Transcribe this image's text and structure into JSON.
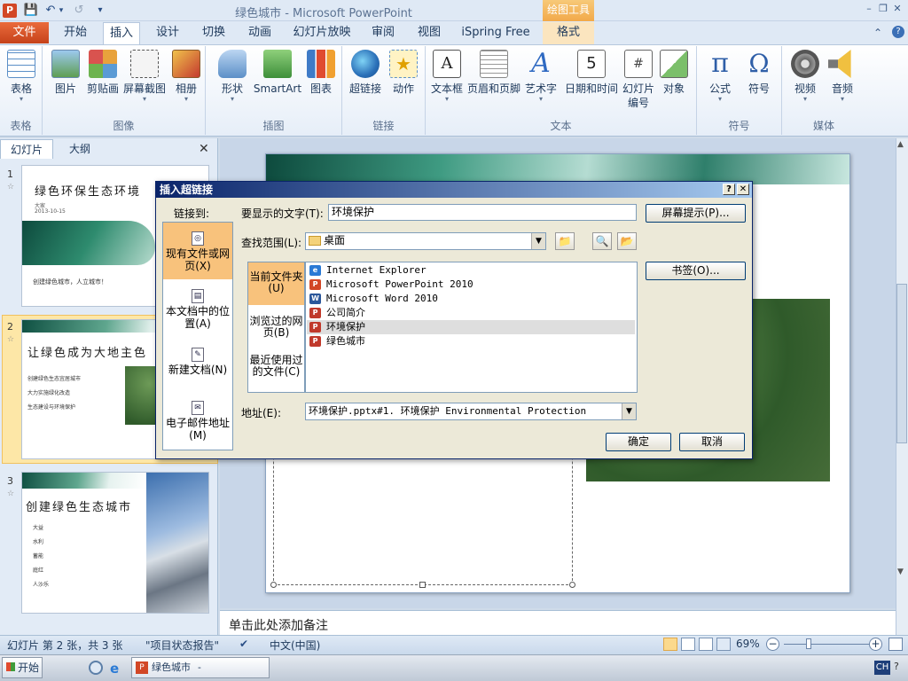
{
  "app": {
    "icon_letter": "P",
    "title": "绿色城市 - Microsoft PowerPoint",
    "context_tool": "绘图工具",
    "qat": {
      "save": "💾",
      "undo": "↶",
      "undo_arrow": "▾",
      "redo": "↺",
      "customize": "▾"
    },
    "window_buttons": {
      "minimize": "–",
      "restore": "❐",
      "close": "✕"
    },
    "ribbon_controls": {
      "help": "?",
      "minimize": "⌃"
    }
  },
  "tabs": [
    "文件",
    "开始",
    "插入",
    "设计",
    "切换",
    "动画",
    "幻灯片放映",
    "审阅",
    "视图",
    "iSpring Free",
    "格式"
  ],
  "ribbon": {
    "groups": [
      {
        "label": "表格",
        "buttons": [
          "表格"
        ]
      },
      {
        "label": "图像",
        "buttons": [
          "图片",
          "剪贴画",
          "屏幕截图",
          "相册"
        ]
      },
      {
        "label": "插图",
        "buttons": [
          "形状",
          "SmartArt",
          "图表"
        ]
      },
      {
        "label": "链接",
        "buttons": [
          "超链接",
          "动作"
        ]
      },
      {
        "label": "文本",
        "buttons": [
          "文本框",
          "页眉和页脚",
          "艺术字",
          "日期和时间",
          "幻灯片编号",
          "对象"
        ]
      },
      {
        "label": "符号",
        "buttons": [
          "公式",
          "符号"
        ]
      },
      {
        "label": "媒体",
        "buttons": [
          "视频",
          "音频"
        ]
      }
    ],
    "icon_glyphs": {
      "formula": "π",
      "symbol": "Ω",
      "wordart": "A",
      "textbox": "A",
      "slide_number": "#",
      "datetime": "5"
    }
  },
  "left_pane": {
    "tab_slides": "幻灯片",
    "tab_outline": "大纲",
    "close": "✕",
    "slides": [
      {
        "num": "1",
        "star": "☆",
        "title": "绿色环保生态环境",
        "sub1": "大家",
        "sub2": "2013-10-15",
        "footer": "创建绿色城市，人立城市！"
      },
      {
        "num": "2",
        "star": "☆",
        "title": "让绿色成为大地主色",
        "bullets": [
          "创建绿色生态宜居城市",
          "大力实施绿化改造",
          "生态建设与环境保护"
        ]
      },
      {
        "num": "3",
        "star": "☆",
        "title": "创建绿色生态城市",
        "bullets": [
          "大益",
          "水利",
          "蓄能",
          "庭红",
          "人沙乐"
        ]
      }
    ]
  },
  "notes_placeholder": "单击此处添加备注",
  "status": {
    "slide_info": "幻灯片 第 2 张，共 3 张",
    "theme": "\"项目状态报告\"",
    "language": "中文(中国)",
    "zoom": "69%",
    "zoom_out": "−",
    "zoom_in": "+"
  },
  "taskbar": {
    "start": "开始",
    "window_item": "绿色城市 - Microsof...",
    "ime": "CH"
  },
  "dialog": {
    "title": "插入超链接",
    "help_btn": "?",
    "close_btn": "✕",
    "link_to_label": "链接到:",
    "link_to_items": [
      {
        "label": "现有文件或网页(X)",
        "selected": true
      },
      {
        "label": "本文档中的位置(A)",
        "selected": false
      },
      {
        "label": "新建文档(N)",
        "selected": false
      },
      {
        "label": "电子邮件地址(M)",
        "selected": false
      }
    ],
    "text_to_display_label": "要显示的文字(T):",
    "text_to_display_value": "环境保护",
    "screentip_button": "屏幕提示(P)...",
    "look_in_label": "查找范围(L):",
    "look_in_value": "桌面",
    "side_items": [
      {
        "label": "当前文件夹(U)",
        "selected": true
      },
      {
        "label": "浏览过的网页(B)",
        "selected": false
      },
      {
        "label": "最近使用过的文件(C)",
        "selected": false
      }
    ],
    "files": [
      {
        "name": "Internet Explorer",
        "icon": "e",
        "color": "#2a7ad5",
        "selected": false
      },
      {
        "name": "Microsoft PowerPoint 2010",
        "icon": "P",
        "color": "#d24726",
        "selected": false
      },
      {
        "name": "Microsoft Word 2010",
        "icon": "W",
        "color": "#2b579a",
        "selected": false
      },
      {
        "name": "公司简介",
        "icon": "P",
        "color": "#c0392b",
        "selected": false
      },
      {
        "name": "环境保护",
        "icon": "P",
        "color": "#c0392b",
        "selected": true
      },
      {
        "name": "绿色城市",
        "icon": "P",
        "color": "#c0392b",
        "selected": false
      }
    ],
    "bookmark_button": "书签(O)...",
    "address_label": "地址(E):",
    "address_value": "环境保护.pptx#1. 环境保护 Environmental Protection",
    "ok_button": "确定",
    "cancel_button": "取消"
  }
}
